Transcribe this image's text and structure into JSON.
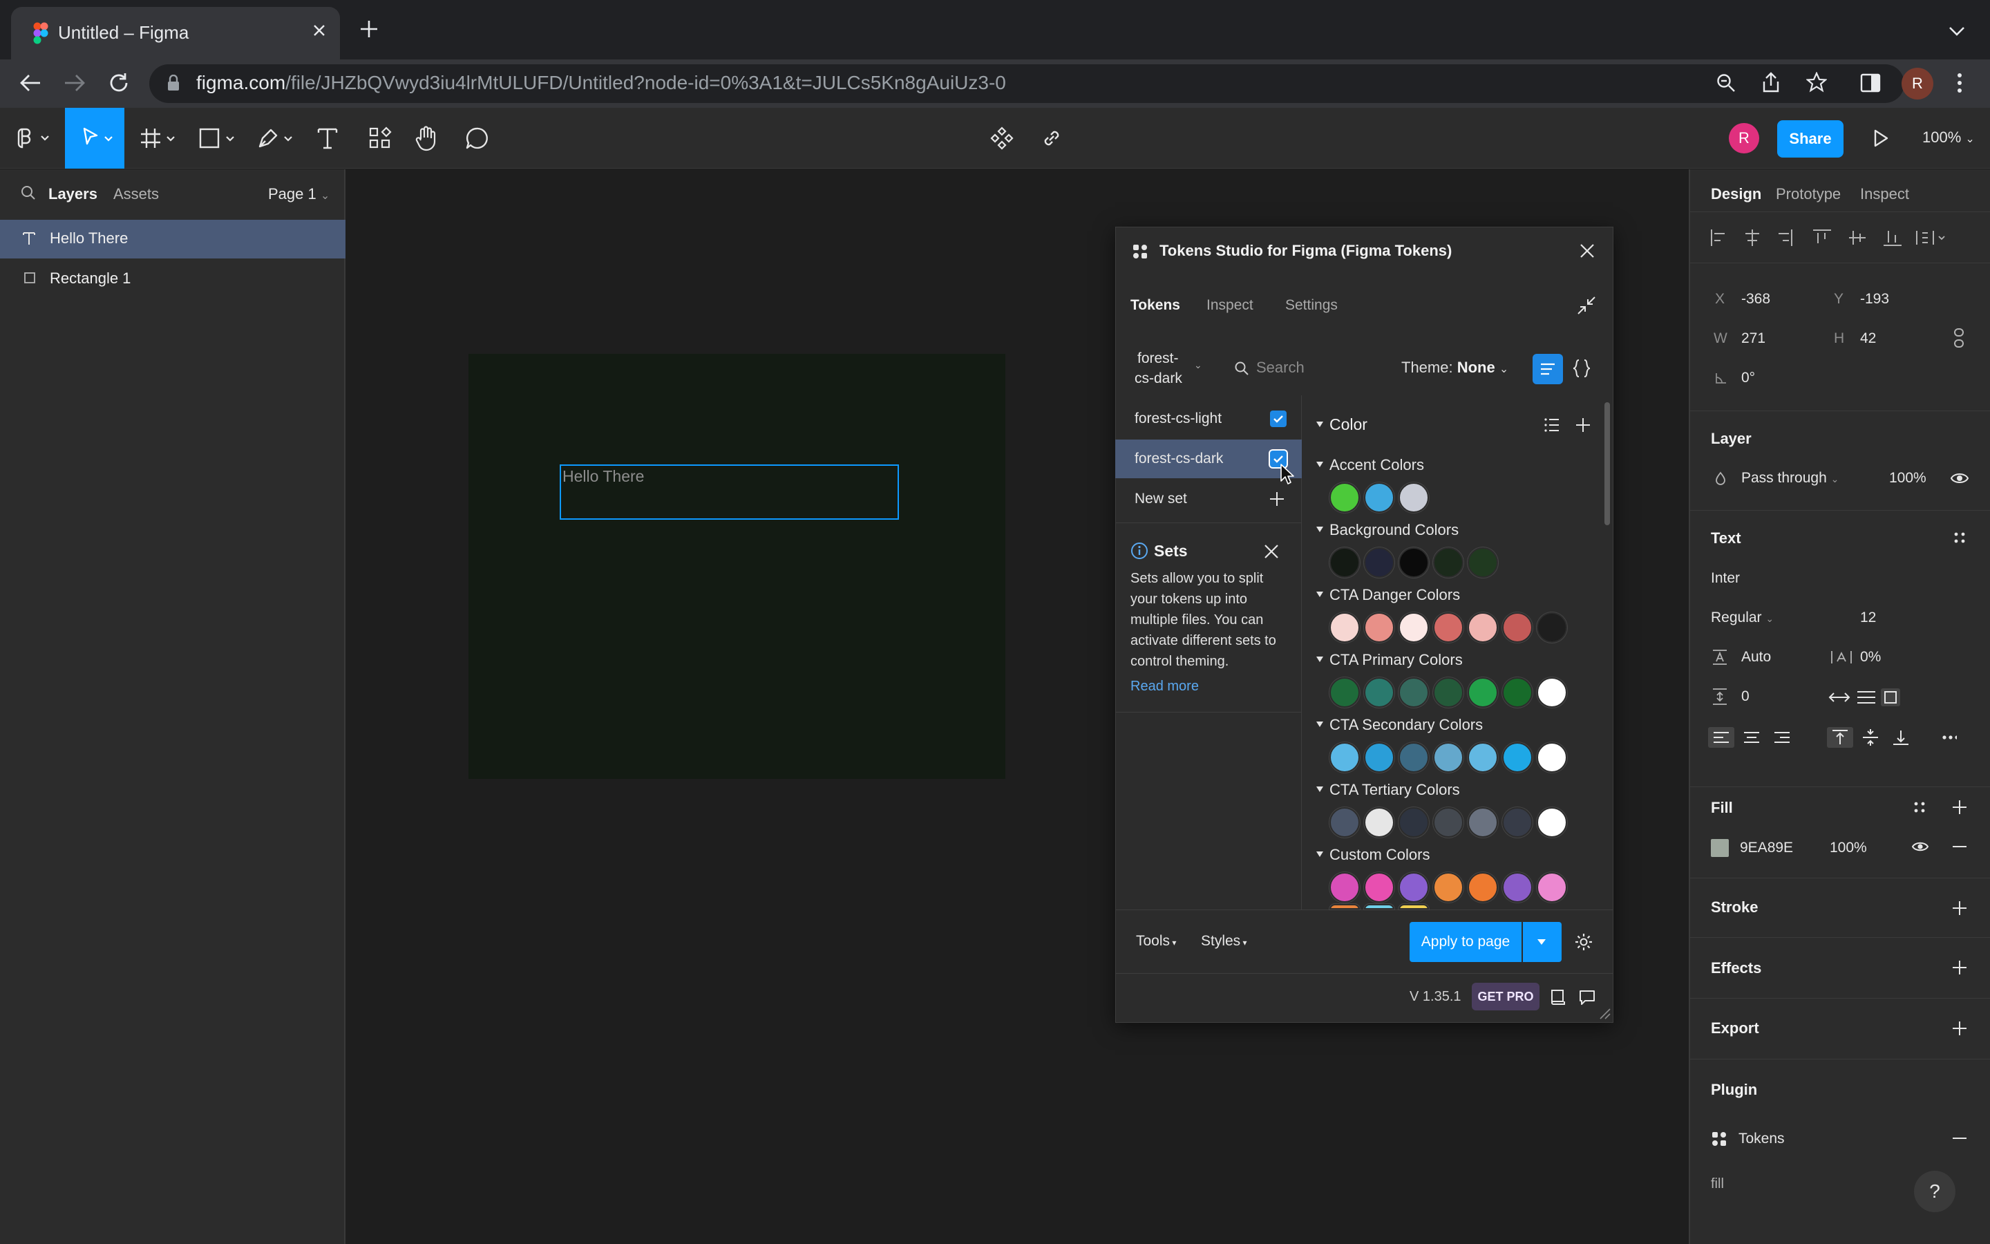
{
  "browser": {
    "tab_title": "Untitled – Figma",
    "url_host": "figma.com",
    "url_path": "/file/JHZbQVwyd3iu4lrMtULUFD/Untitled?node-id=0%3A1&t=JULCs5Kn8gAuiUz3-0",
    "profile_initial": "R"
  },
  "figma_toolbar": {
    "avatar_initial": "R",
    "share_label": "Share",
    "zoom_label": "100%"
  },
  "left_panel": {
    "tabs": [
      "Layers",
      "Assets"
    ],
    "page": "Page 1",
    "layers": [
      {
        "label": "Hello There",
        "type": "text",
        "selected": true
      },
      {
        "label": "Rectangle 1",
        "type": "rectangle",
        "selected": false
      }
    ]
  },
  "canvas": {
    "text_content": "Hello There"
  },
  "plugin": {
    "title": "Tokens Studio for Figma (Figma Tokens)",
    "tabs": [
      "Tokens",
      "Inspect",
      "Settings"
    ],
    "active_set_line1": "forest-",
    "active_set_line2": "cs-dark",
    "search_placeholder": "Search",
    "theme_label": "Theme:",
    "theme_value": "None",
    "sets": [
      {
        "label": "forest-cs-light",
        "checked": true
      },
      {
        "label": "forest-cs-dark",
        "checked": true
      }
    ],
    "new_set_label": "New set",
    "sets_info": {
      "title": "Sets",
      "body": "Sets allow you to split your tokens up into multiple files. You can activate different sets to control theming.",
      "link": "Read more"
    },
    "color_section_title": "Color",
    "groups": [
      {
        "title": "Accent Colors",
        "colors": [
          "#4cc93a",
          "#3fa9e0",
          "#c9ccd6"
        ]
      },
      {
        "title": "Background Colors",
        "colors": [
          "#141a14",
          "#23263a",
          "#0b0b0b",
          "#1b2a1b",
          "#203a20"
        ]
      },
      {
        "title": "CTA Danger Colors",
        "colors": [
          "#f6d6d2",
          "#e89088",
          "#fbe8e6",
          "#d46a66",
          "#f0b4b0",
          "#c45a58",
          "#1e1e1e"
        ]
      },
      {
        "title": "CTA Primary Colors",
        "colors": [
          "#1e6b3a",
          "#2a7a6e",
          "#356a5e",
          "#245a3a",
          "#22a24a",
          "#176b2a",
          "#ffffff"
        ]
      },
      {
        "title": "CTA Secondary Colors",
        "colors": [
          "#5ab8e6",
          "#2a9ed8",
          "#3c6a84",
          "#64a8cc",
          "#62b8e2",
          "#1ea8e6",
          "#ffffff"
        ]
      },
      {
        "title": "CTA Tertiary Colors",
        "colors": [
          "#4a5568",
          "#e6e6e6",
          "#2e3440",
          "#444950",
          "#6a7280",
          "#373c48",
          "#ffffff"
        ]
      },
      {
        "title": "Custom Colors",
        "colors": [
          "#d94fb8",
          "#e84fb0",
          "#8a5fd0",
          "#ec8a3c",
          "#ee7a30",
          "#8a5cc8",
          "#ec88d0"
        ]
      }
    ],
    "tools_label": "Tools",
    "styles_label": "Styles",
    "apply_label": "Apply to page",
    "version": "V 1.35.1",
    "get_pro": "GET PRO"
  },
  "right_panel": {
    "tabs": [
      "Design",
      "Prototype",
      "Inspect"
    ],
    "x_label": "X",
    "x_value": "-368",
    "y_label": "Y",
    "y_value": "-193",
    "w_label": "W",
    "w_value": "271",
    "h_label": "H",
    "h_value": "42",
    "rotation": "0°",
    "layer_title": "Layer",
    "blend_mode": "Pass through",
    "layer_opacity": "100%",
    "text_title": "Text",
    "font_family": "Inter",
    "font_weight": "Regular",
    "font_size": "12",
    "line_height": "Auto",
    "letter_spacing": "0%",
    "paragraph_spacing": "0",
    "fill_title": "Fill",
    "fill_hex": "9EA89E",
    "fill_opacity": "100%",
    "stroke_title": "Stroke",
    "effects_title": "Effects",
    "export_title": "Export",
    "plugin_title": "Plugin",
    "plugin_name": "Tokens",
    "plugin_field": "fill",
    "help": "?"
  }
}
